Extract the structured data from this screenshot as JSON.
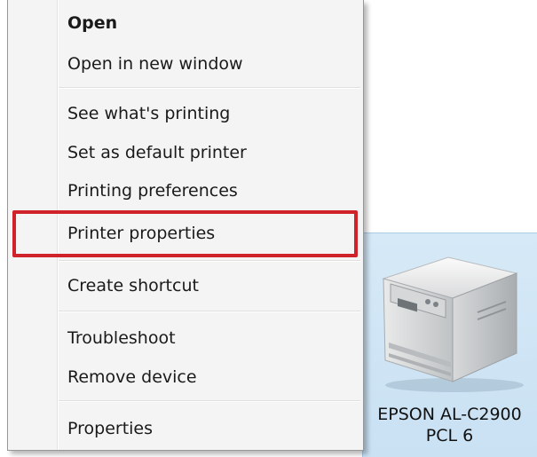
{
  "context_menu": {
    "items": [
      {
        "label": "Open",
        "bold": true
      },
      {
        "label": "Open in new window"
      },
      {
        "label": "See what's printing"
      },
      {
        "label": "Set as default printer"
      },
      {
        "label": "Printing preferences"
      },
      {
        "label": "Printer properties",
        "highlighted": true
      },
      {
        "label": "Create shortcut"
      },
      {
        "label": "Troubleshoot"
      },
      {
        "label": "Remove device"
      },
      {
        "label": "Properties"
      }
    ]
  },
  "device": {
    "name_line1": "EPSON AL-C2900",
    "name_line2": "PCL 6",
    "icon": "printer-icon"
  },
  "colors": {
    "highlight": "#d0222b",
    "selection_tile": "#cfe5f5",
    "menu_background": "#f4f4f4"
  }
}
